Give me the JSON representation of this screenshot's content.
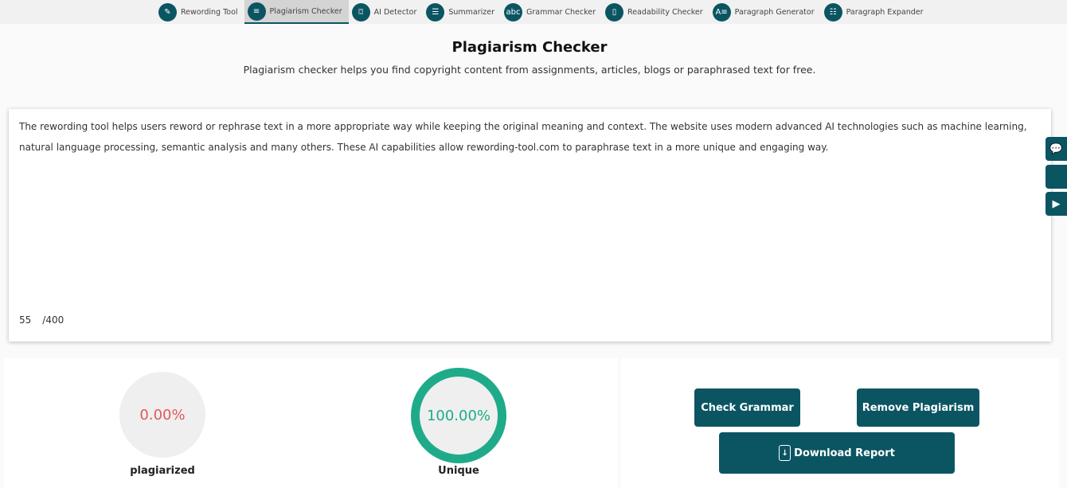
{
  "nav": {
    "items": [
      {
        "label": "Rewording Tool",
        "icon": "document-edit-icon",
        "glyph": "✎"
      },
      {
        "label": "Plagiarism Checker",
        "icon": "text-search-icon",
        "glyph": "≡"
      },
      {
        "label": "AI Detector",
        "icon": "ai-scan-icon",
        "glyph": "⌼"
      },
      {
        "label": "Summarizer",
        "icon": "summary-icon",
        "glyph": "☰"
      },
      {
        "label": "Grammar Checker",
        "icon": "abc-icon",
        "glyph": "abc"
      },
      {
        "label": "Readability Checker",
        "icon": "book-icon",
        "glyph": "▯"
      },
      {
        "label": "Paragraph Generator",
        "icon": "text-generate-icon",
        "glyph": "A≡"
      },
      {
        "label": "Paragraph Expander",
        "icon": "list-expand-icon",
        "glyph": "☷"
      }
    ],
    "active": 1
  },
  "page": {
    "title": "Plagiarism Checker",
    "subtitle": "Plagiarism checker helps you find copyright content from assignments, articles, blogs or paraphrased text for free."
  },
  "editor": {
    "text": "The rewording tool helps users reword or rephrase text in a more appropriate way while keeping the original meaning and context. The website uses modern advanced AI technologies such as machine learning, natural language processing, semantic analysis and many others. These AI capabilities allow rewording-tool.com to paraphrase text in a more unique and engaging way.",
    "word_count": "55",
    "word_limit": "/400"
  },
  "side": [
    "chat-icon",
    "apple-icon",
    "play-store-icon"
  ],
  "results": {
    "plagiarized_value": "0.00%",
    "plagiarized_label": "plagiarized",
    "unique_value": "100.00%",
    "unique_label": "Unique",
    "unique_percent": 100
  },
  "actions": {
    "check_grammar": "Check Grammar",
    "remove_plagiarism": "Remove Plagiarism",
    "download_report": "Download Report"
  },
  "colors": {
    "primary": "#0b5563",
    "plagiarized": "#e05a5a",
    "unique": "#1fab89"
  }
}
